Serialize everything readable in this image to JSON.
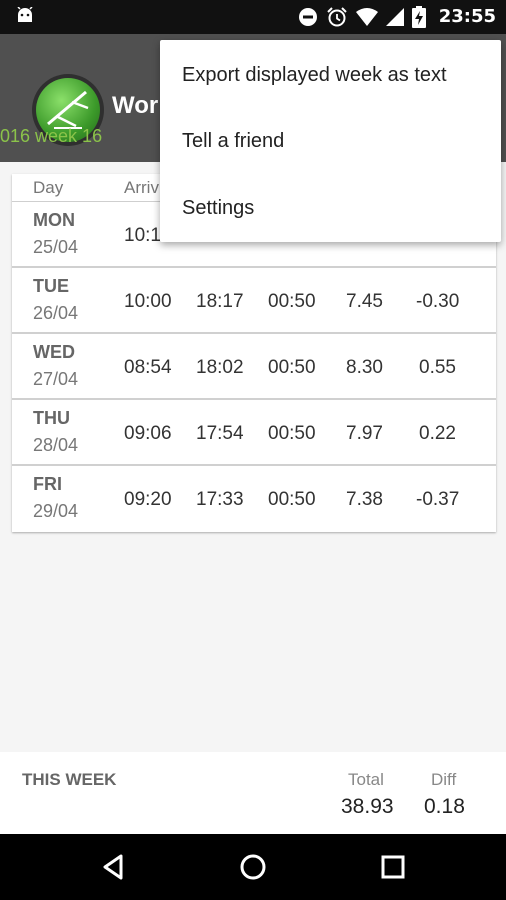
{
  "status_bar": {
    "time": "23:55",
    "icons": [
      "android-icon",
      "do-not-disturb-icon",
      "alarm-icon",
      "wifi-icon",
      "signal-icon",
      "battery-charging-icon"
    ]
  },
  "app_bar": {
    "title": "Wor",
    "week_label": "016 week 16"
  },
  "table": {
    "columns": [
      "Day",
      "Arriv"
    ],
    "rows": [
      {
        "day": "MON",
        "date": "25/04",
        "arrival": "10:1",
        "departure": "",
        "break": "",
        "total": "",
        "diff": ""
      },
      {
        "day": "TUE",
        "date": "26/04",
        "arrival": "10:00",
        "departure": "18:17",
        "break": "00:50",
        "total": "7.45",
        "diff": "-0.30"
      },
      {
        "day": "WED",
        "date": "27/04",
        "arrival": "08:54",
        "departure": "18:02",
        "break": "00:50",
        "total": "8.30",
        "diff": "0.55"
      },
      {
        "day": "THU",
        "date": "28/04",
        "arrival": "09:06",
        "departure": "17:54",
        "break": "00:50",
        "total": "7.97",
        "diff": "0.22"
      },
      {
        "day": "FRI",
        "date": "29/04",
        "arrival": "09:20",
        "departure": "17:33",
        "break": "00:50",
        "total": "7.38",
        "diff": "-0.37"
      }
    ]
  },
  "menu": {
    "items": [
      "Export displayed week as text",
      "Tell a friend",
      "Settings"
    ]
  },
  "footer": {
    "label": "THIS WEEK",
    "total_label": "Total",
    "diff_label": "Diff",
    "total_value": "38.93",
    "diff_value": "0.18"
  },
  "nav_bar": {
    "buttons": [
      "back-icon",
      "home-icon",
      "recents-icon"
    ]
  }
}
